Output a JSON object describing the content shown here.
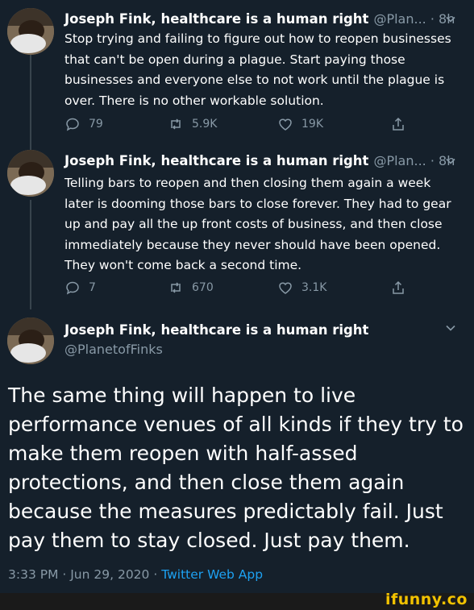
{
  "colors": {
    "background": "#15202b",
    "text_primary": "#ffffff",
    "text_secondary": "#8899a6",
    "link": "#1da1f2",
    "watermark": "#f2c200"
  },
  "tweets": [
    {
      "display_name": "Joseph Fink, healthcare is a human right",
      "handle_time": "@Plan... · 8h",
      "text": "Stop trying and failing to figure out how to reopen businesses that can't be open during a plague. Start paying those businesses and everyone else to not work until the plague is over. There is no other workable solution.",
      "replies": "79",
      "retweets": "5.9K",
      "likes": "19K"
    },
    {
      "display_name": "Joseph Fink, healthcare is a human right",
      "handle_time": "@Plan... · 8h",
      "text": "Telling bars to reopen and then closing them again a week later is dooming those bars to close forever. They had to gear up and pay all the up front costs of business, and then close immediately because they never should have been opened. They won't come back a second time.",
      "replies": "7",
      "retweets": "670",
      "likes": "3.1K"
    }
  ],
  "main_tweet": {
    "display_name": "Joseph Fink, healthcare is a human right",
    "handle": "@PlanetofFinks",
    "text": "The same thing will happen to live performance venues of all kinds if they try to make them reopen with half-assed protections, and then close them again because the measures predictably fail. Just pay them to stay closed. Just pay them.",
    "timestamp": "3:33 PM · Jun 29, 2020 · ",
    "source": "Twitter Web App"
  },
  "watermark": "ifunny.co",
  "icons": [
    "avatar",
    "chevron-down-icon",
    "reply-icon",
    "retweet-icon",
    "like-icon",
    "share-icon"
  ]
}
